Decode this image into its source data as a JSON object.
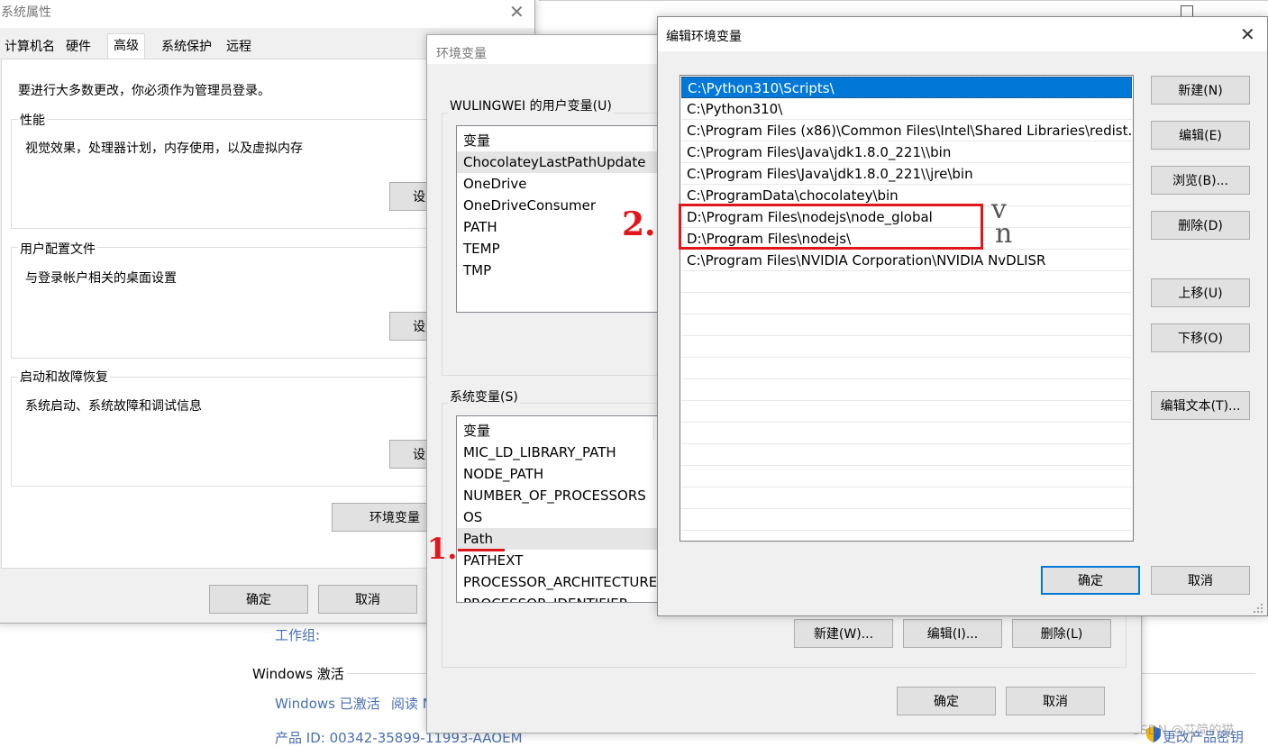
{
  "background": {
    "workgroup_label": "工作组:",
    "activation_heading": "Windows 激活",
    "activation_status": "Windows 已激活",
    "read_link": "阅读 M",
    "product_id": "产品 ID: 00342-35899-11993-AAOEM",
    "change_key": "更改产品密钥",
    "watermark": "CSDN @艾简的猫"
  },
  "sysprops": {
    "title": "系统属性",
    "tabs": [
      "计算机名",
      "硬件",
      "高级",
      "系统保护",
      "远程"
    ],
    "admin_note": "要进行大多数更改，你必须作为管理员登录。",
    "perf_label": "性能",
    "perf_desc": "视觉效果，处理器计划，内存使用，以及虚拟内存",
    "settings_btn": "设置",
    "profile_label": "用户配置文件",
    "profile_desc": "与登录帐户相关的桌面设置",
    "startup_label": "启动和故障恢复",
    "startup_desc": "系统启动、系统故障和调试信息",
    "env_btn": "环境变量",
    "ok": "确定",
    "cancel": "取消"
  },
  "envvars": {
    "title": "环境变量",
    "user_group": "WULINGWEI 的用户变量(U)",
    "user_header": "变量",
    "user_vars": [
      "ChocolateyLastPathUpdate",
      "OneDrive",
      "OneDriveConsumer",
      "PATH",
      "TEMP",
      "TMP"
    ],
    "sys_group": "系统变量(S)",
    "sys_header": "变量",
    "sys_vars": [
      "MIC_LD_LIBRARY_PATH",
      "NODE_PATH",
      "NUMBER_OF_PROCESSORS",
      "OS",
      "Path",
      "PATHEXT",
      "PROCESSOR_ARCHITECTURE",
      "PROCESSOR_IDENTIFIER"
    ],
    "new_btn": "新建(W)...",
    "edit_btn": "编辑(I)...",
    "delete_btn": "删除(L)",
    "ok": "确定",
    "cancel": "取消"
  },
  "editor": {
    "title": "编辑环境变量",
    "paths": [
      "C:\\Python310\\Scripts\\",
      "C:\\Python310\\",
      "C:\\Program Files (x86)\\Common Files\\Intel\\Shared Libraries\\redist...",
      "C:\\Program Files\\Java\\jdk1.8.0_221\\\\bin",
      "C:\\Program Files\\Java\\jdk1.8.0_221\\\\jre\\bin",
      "C:\\ProgramData\\chocolatey\\bin",
      "D:\\Program Files\\nodejs\\node_global",
      "D:\\Program Files\\nodejs\\",
      "C:\\Program Files\\NVIDIA Corporation\\NVIDIA NvDLISR"
    ],
    "new_btn": "新建(N)",
    "edit_btn": "编辑(E)",
    "browse_btn": "浏览(B)...",
    "delete_btn": "删除(D)",
    "up_btn": "上移(U)",
    "down_btn": "下移(O)",
    "edit_text_btn": "编辑文本(T)...",
    "ok": "确定",
    "cancel": "取消"
  },
  "annotations": {
    "step1": "1.",
    "step2": "2.",
    "mark_v": "v",
    "mark_n": "n"
  }
}
